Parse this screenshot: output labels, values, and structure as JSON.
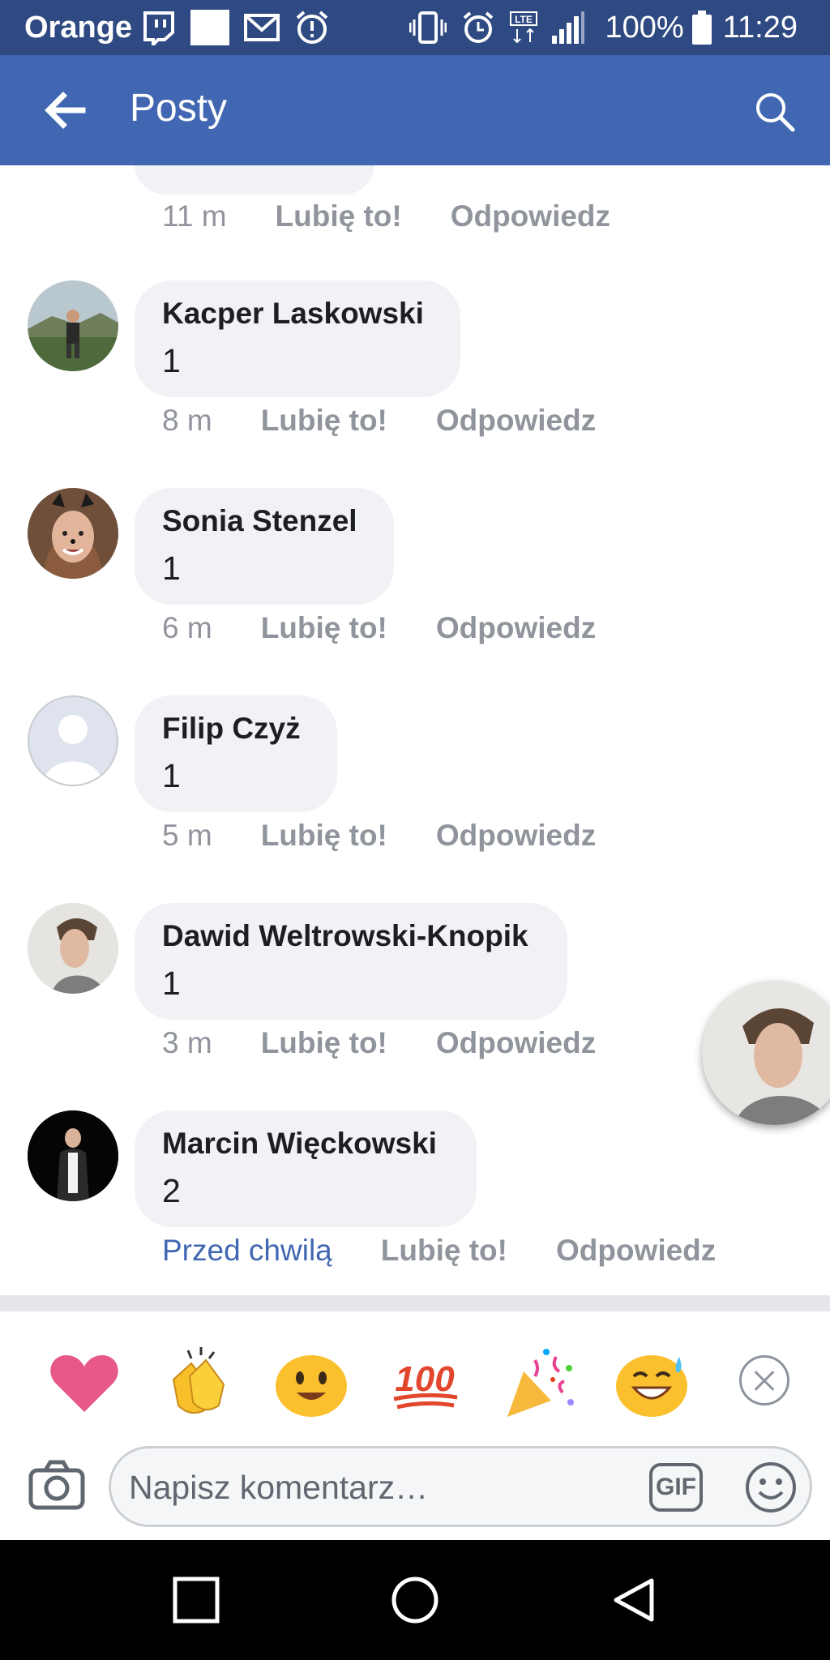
{
  "status_bar": {
    "carrier": "Orange",
    "battery": "100%",
    "time": "11:29",
    "network": "LTE",
    "icons": [
      "twitch-icon",
      "white-square-icon",
      "gmail-icon",
      "alarm-warning-icon",
      "vibrate-icon",
      "alarm-icon",
      "lte-icon",
      "signal-icon",
      "battery-icon"
    ]
  },
  "app_bar": {
    "title": "Posty",
    "back_icon": "arrow-left-icon",
    "search_icon": "search-icon",
    "bg_color": "#4267b2"
  },
  "comments": {
    "partial": {
      "time": "11 m",
      "like": "Lubię to!",
      "reply": "Odpowiedz"
    },
    "items": [
      {
        "name": "Kacper Laskowski",
        "text": "1",
        "time": "8 m",
        "like": "Lubię to!",
        "reply": "Odpowiedz"
      },
      {
        "name": "Sonia Stenzel",
        "text": "1",
        "time": "6 m",
        "like": "Lubię to!",
        "reply": "Odpowiedz"
      },
      {
        "name": "Filip Czyż",
        "text": "1",
        "time": "5 m",
        "like": "Lubię to!",
        "reply": "Odpowiedz"
      },
      {
        "name": "Dawid Weltrowski-Knopik",
        "text": "1",
        "time": "3 m",
        "like": "Lubię to!",
        "reply": "Odpowiedz"
      },
      {
        "name": "Marcin Więckowski",
        "text": "2",
        "time": "Przed chwilą",
        "like": "Lubię to!",
        "reply": "Odpowiedz"
      }
    ]
  },
  "emoji_bar": {
    "items": [
      "heart-emoji",
      "clapping-hands-emoji",
      "smiling-face-emoji",
      "hundred-points-emoji",
      "party-popper-emoji",
      "grinning-sweat-emoji"
    ],
    "close_icon": "close-circle-icon"
  },
  "composer": {
    "placeholder": "Napisz komentarz…",
    "gif_label": "GIF",
    "camera_icon": "camera-icon",
    "emoji_icon": "smiley-icon"
  },
  "nav_bar": {
    "buttons": [
      "recent-apps-button",
      "home-button",
      "back-button"
    ]
  }
}
